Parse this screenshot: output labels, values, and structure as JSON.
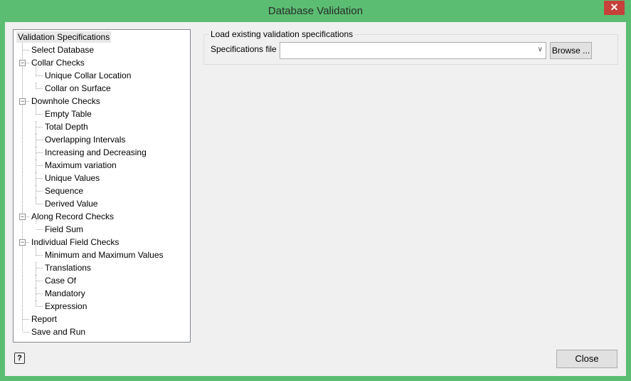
{
  "window": {
    "title": "Database Validation",
    "close_glyph": "✕"
  },
  "tree": [
    {
      "label": "Validation Specifications",
      "level": 0,
      "selected": true
    },
    {
      "label": "Select Database",
      "level": 1
    },
    {
      "label": "Collar Checks",
      "level": 1,
      "expander": true
    },
    {
      "label": "Unique Collar Location",
      "level": 2
    },
    {
      "label": "Collar on Surface",
      "level": 2
    },
    {
      "label": "Downhole Checks",
      "level": 1,
      "expander": true
    },
    {
      "label": "Empty Table",
      "level": 2
    },
    {
      "label": "Total Depth",
      "level": 2
    },
    {
      "label": "Overlapping Intervals",
      "level": 2
    },
    {
      "label": "Increasing and Decreasing",
      "level": 2
    },
    {
      "label": "Maximum variation",
      "level": 2
    },
    {
      "label": "Unique Values",
      "level": 2
    },
    {
      "label": "Sequence",
      "level": 2
    },
    {
      "label": "Derived Value",
      "level": 2
    },
    {
      "label": "Along Record Checks",
      "level": 1,
      "expander": true
    },
    {
      "label": "Field Sum",
      "level": 2
    },
    {
      "label": "Individual Field Checks",
      "level": 1,
      "expander": true
    },
    {
      "label": "Minimum and Maximum Values",
      "level": 2
    },
    {
      "label": "Translations",
      "level": 2
    },
    {
      "label": "Case Of",
      "level": 2
    },
    {
      "label": "Mandatory",
      "level": 2
    },
    {
      "label": "Expression",
      "level": 2
    },
    {
      "label": "Report",
      "level": 1
    },
    {
      "label": "Save and Run",
      "level": 1
    }
  ],
  "load": {
    "group_label": "Load existing validation specifications",
    "field_label": "Specifications file",
    "value": "",
    "browse_label": "Browse ..."
  },
  "footer": {
    "help_glyph": "?",
    "close_label": "Close"
  }
}
